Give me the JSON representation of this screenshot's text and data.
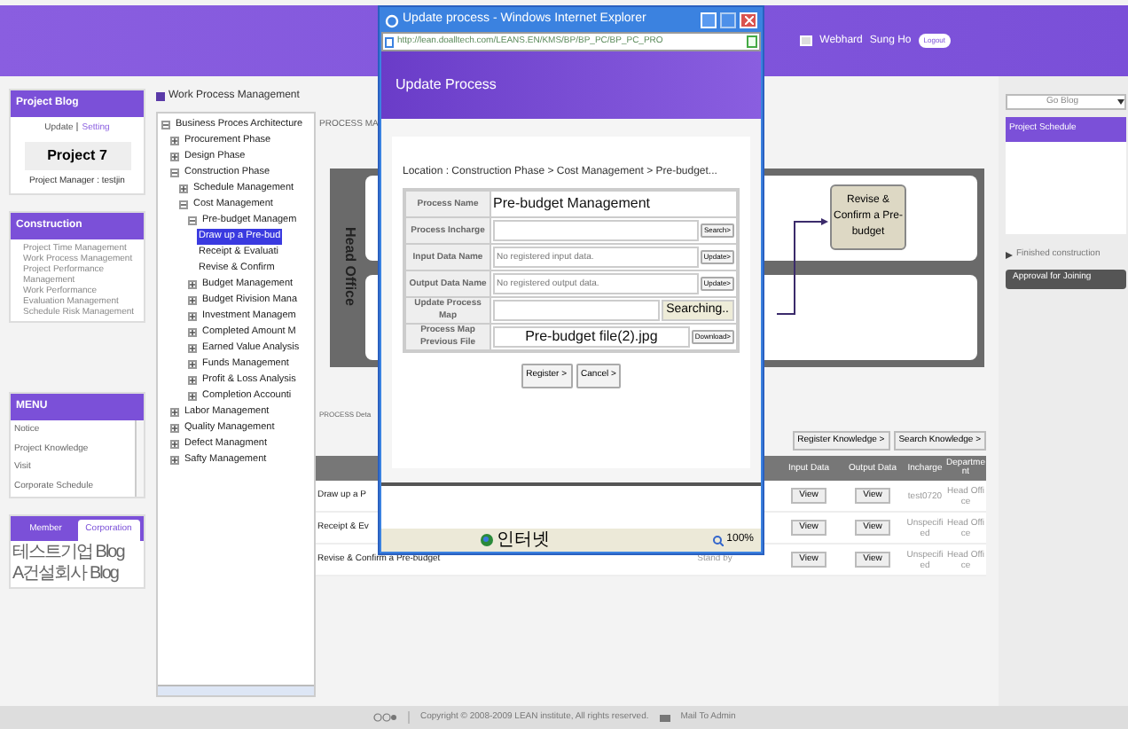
{
  "header": {
    "link": "Webhard",
    "user": "Sung Ho",
    "logout": "Logout"
  },
  "project_blog": {
    "title": "Project Blog",
    "update": "Update",
    "setting": "Setting",
    "project": "Project 7",
    "manager": "Project Manager : testjin"
  },
  "construction": {
    "title": "Construction",
    "items": [
      "Project Time Management",
      "Work Process Management",
      "Project Performance Management",
      "Work Performance Evaluation Management",
      "Schedule Risk Management"
    ]
  },
  "menu": {
    "title": "MENU",
    "items": [
      "Notice",
      "Project Knowledge",
      "Visit",
      "Corporate Schedule"
    ]
  },
  "blog_tabs": [
    {
      "label": "Member",
      "selected": false
    },
    {
      "label": "Corporation",
      "selected": true
    }
  ],
  "blogs": [
    "테스트기업 Blog",
    "A건설회사 Blog"
  ],
  "page_title": "Work Process Management",
  "tree": {
    "label": "Business Proces Architecture",
    "expanded": true,
    "selected": false,
    "children": [
      {
        "label": "Procurement Phase",
        "expanded": false,
        "selected": false
      },
      {
        "label": "Design Phase",
        "expanded": false,
        "selected": false
      },
      {
        "label": "Construction Phase",
        "expanded": true,
        "selected": false,
        "children": [
          {
            "label": "Schedule Management",
            "expanded": false,
            "selected": false
          },
          {
            "label": "Cost Management",
            "expanded": true,
            "selected": false,
            "children": [
              {
                "label": "Pre-budget Managem",
                "expanded": true,
                "selected": false,
                "children": [
                  {
                    "label": "Draw up a Pre-bud",
                    "kind": "leaf",
                    "selected": true
                  },
                  {
                    "label": "Receipt & Evaluati",
                    "kind": "leaf",
                    "selected": false
                  },
                  {
                    "label": "Revise & Confirm",
                    "kind": "leaf",
                    "selected": false
                  }
                ]
              },
              {
                "label": "Budget Management",
                "expanded": false,
                "selected": false
              },
              {
                "label": "Budget Rivision Mana",
                "expanded": false,
                "selected": false
              },
              {
                "label": "Investment Managem",
                "expanded": false,
                "selected": false
              },
              {
                "label": "Completed Amount M",
                "expanded": false,
                "selected": false
              },
              {
                "label": "Earned Value Analysis",
                "expanded": false,
                "selected": false
              },
              {
                "label": "Funds Management",
                "expanded": false,
                "selected": false
              },
              {
                "label": "Profit & Loss Analysis",
                "expanded": false,
                "selected": false
              },
              {
                "label": "Completion Accounti",
                "expanded": false,
                "selected": false
              }
            ]
          }
        ]
      },
      {
        "label": "Labor Management",
        "expanded": false,
        "selected": false
      },
      {
        "label": "Quality Management",
        "expanded": false,
        "selected": false
      },
      {
        "label": "Defect Managment",
        "expanded": false,
        "selected": false
      },
      {
        "label": "Safty Management",
        "expanded": false,
        "selected": false
      }
    ]
  },
  "process_map": {
    "label": "PROCESS MA",
    "lane": "Head Office",
    "node": "Revise & Confirm a Pre-budget"
  },
  "process_detail": {
    "label": "PROCESS Deta",
    "buttons": [
      "Register Knowledge >",
      "Search Knowledge >"
    ]
  },
  "table": {
    "columns": [
      "Input Data",
      "Output Data",
      "Incharge",
      "Department"
    ],
    "rows": [
      {
        "name": "Draw up a P",
        "input": "View",
        "output": "View",
        "incharge": "test0720",
        "department": "Head Office"
      },
      {
        "name": "Receipt & Ev",
        "input": "View",
        "output": "View",
        "incharge": "Unspecified",
        "department": "Head Office"
      },
      {
        "name": "Revise & Confirm a Pre-budget",
        "status": "Stand by",
        "input": "View",
        "output": "View",
        "incharge": "Unspecified",
        "department": "Head Office"
      }
    ]
  },
  "right": {
    "go_blog": "Go Blog",
    "schedule_title": "Project Schedule",
    "finished": "Finished construction",
    "approval": "Approval for Joining"
  },
  "footer": {
    "copyright": "Copyright © 2008-2009 LEAN institute, All rights reserved.",
    "mail": "Mail To Admin"
  },
  "popup": {
    "title": "Update process - Windows Internet Explorer",
    "url": "http://lean.doalltech.com/LEANS.EN/KMS/BP/BP_PC/BP_PC_PRO",
    "heading": "Update Process",
    "location": "Location : Construction Phase > Cost Management > Pre-budget...",
    "fields": [
      {
        "label": "Process Name",
        "kind": "text",
        "value": "Pre-budget Management"
      },
      {
        "label": "Process Incharge",
        "kind": "input",
        "button": "Search>"
      },
      {
        "label": "Input Data Name",
        "kind": "input",
        "placeholder": "No registered input data.",
        "button": "Update>"
      },
      {
        "label": "Output Data Name",
        "kind": "input",
        "placeholder": "No registered output data.",
        "button": "Update>"
      },
      {
        "label": "Update Process Map",
        "kind": "file",
        "button": "Searching.."
      },
      {
        "label": "Process Map Previous File",
        "kind": "filename",
        "value": "Pre-budget file(2).jpg",
        "button": "Download>"
      }
    ],
    "actions": [
      "Register >",
      "Cancel >"
    ],
    "zone": "인터넷",
    "zoom": "100%"
  }
}
